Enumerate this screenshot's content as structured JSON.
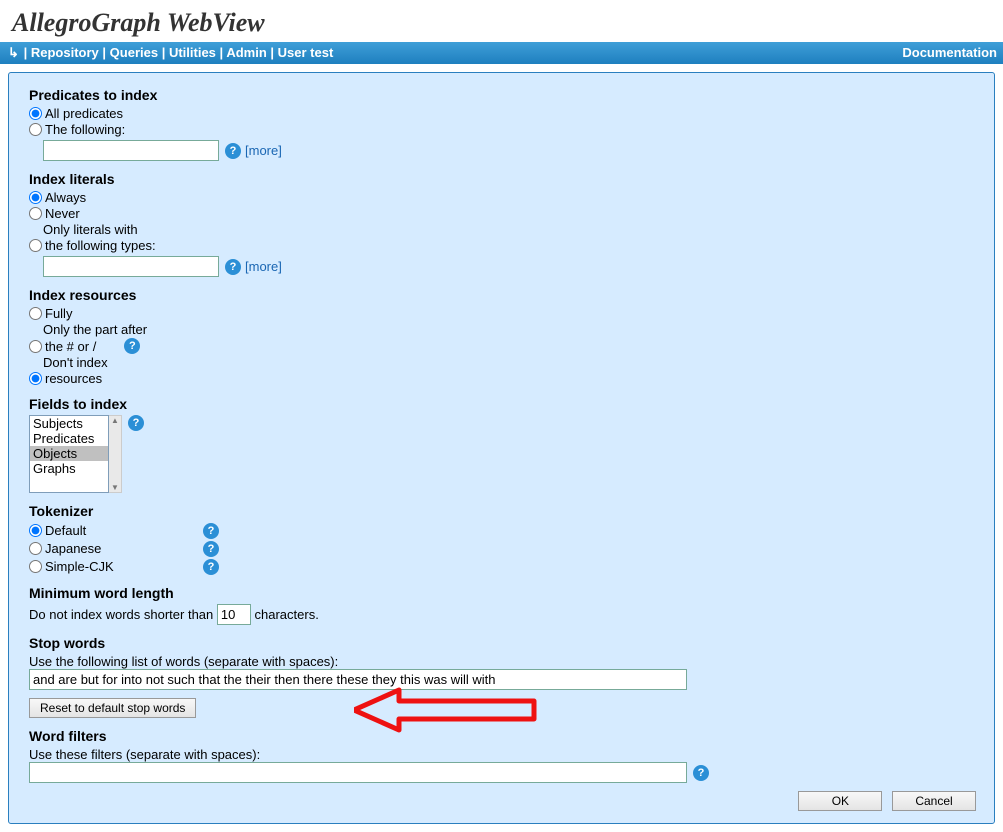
{
  "app_title": "AllegroGraph WebView",
  "nav": {
    "back": "↳",
    "sep": " | ",
    "repository": "Repository",
    "queries": "Queries",
    "utilities": "Utilities",
    "admin": "Admin",
    "user": "User test",
    "documentation": "Documentation"
  },
  "predicates": {
    "title": "Predicates to index",
    "all": "All predicates",
    "following": "The following:",
    "more": "[more]"
  },
  "literals": {
    "title": "Index literals",
    "always": "Always",
    "never": "Never",
    "only_lead": "Only literals with",
    "following": "the following types:",
    "more": "[more]"
  },
  "resources": {
    "title": "Index resources",
    "fully": "Fully",
    "only_part": "Only the part after",
    "hash_or_slash": "the # or /",
    "dont_index": "Don't index",
    "resources_opt": "resources"
  },
  "fields": {
    "title": "Fields to index",
    "options": [
      "Subjects",
      "Predicates",
      "Objects",
      "Graphs"
    ],
    "selected": "Objects"
  },
  "tokenizer": {
    "title": "Tokenizer",
    "default": "Default",
    "japanese": "Japanese",
    "simple_cjk": "Simple-CJK"
  },
  "minlen": {
    "title": "Minimum word length",
    "pre": "Do not index words shorter than ",
    "value": "10",
    "post": " characters."
  },
  "stop": {
    "title": "Stop words",
    "desc": "Use the following list of words (separate with spaces):",
    "value": "and are but for into not such that the their then there these they this was will with",
    "reset": "Reset to default stop words"
  },
  "filters": {
    "title": "Word filters",
    "desc": "Use these filters (separate with spaces):"
  },
  "buttons": {
    "ok": "OK",
    "cancel": "Cancel"
  },
  "help_glyph": "?"
}
